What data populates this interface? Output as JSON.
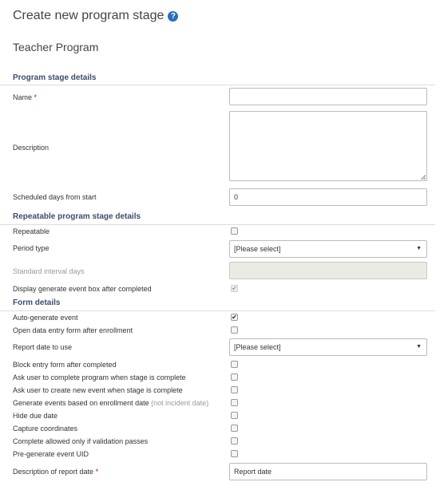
{
  "page": {
    "title": "Create new program stage",
    "help_icon": "?",
    "program_name": "Teacher Program"
  },
  "sections": {
    "details": "Program stage details",
    "repeatable": "Repeatable program stage details",
    "form": "Form details"
  },
  "required_marker": "*",
  "fields": {
    "name_label": "Name",
    "name_value": "",
    "description_label": "Description",
    "description_value": "",
    "scheduled_days_label": "Scheduled days from start",
    "scheduled_days_value": "0",
    "repeatable_label": "Repeatable",
    "repeatable_checked": false,
    "period_type_label": "Period type",
    "period_type_value": "[Please select]",
    "standard_interval_label": "Standard interval days",
    "standard_interval_value": "",
    "display_generate_label": "Display generate event box after completed",
    "display_generate_checked": true,
    "auto_generate_label": "Auto-generate event",
    "auto_generate_checked": true,
    "open_data_entry_label": "Open data entry form after enrollment",
    "report_date_label": "Report date to use",
    "report_date_value": "[Please select]",
    "block_entry_label": "Block entry form after completed",
    "ask_complete_program_label": "Ask user to complete program when stage is complete",
    "ask_create_event_label": "Ask user to create new event when stage is complete",
    "generate_events_label": "Generate events based on enrollment date",
    "generate_events_note": "(not incident date)",
    "hide_due_date_label": "Hide due date",
    "capture_coordinates_label": "Capture coordinates",
    "complete_allowed_label": "Complete allowed only if validation passes",
    "pregenerate_uid_label": "Pre-generate event UID",
    "report_date_desc_label": "Description of report date",
    "report_date_desc_value": "Report date"
  },
  "icons": {
    "checkmark": "✔",
    "dropdown_arrow": "▼"
  }
}
